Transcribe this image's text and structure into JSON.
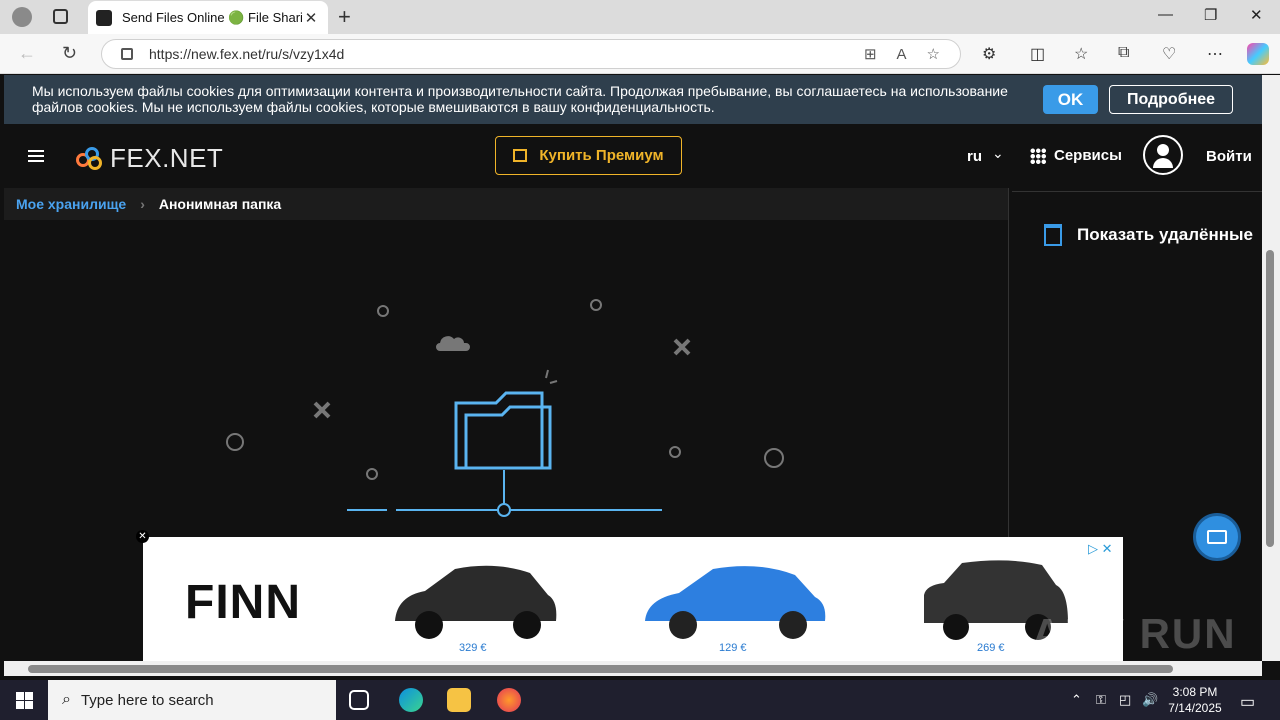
{
  "browser": {
    "tab_title": "Send Files Online 🟢 File Sharing",
    "url": "https://new.fex.net/ru/s/vzy1x4d"
  },
  "cookie": {
    "text": "Мы используем файлы cookies для оптимизации контента и производительности сайта. Продолжая пребывание, вы соглашаетесь на использование файлов cookies. Мы не используем файлы cookies, которые вмешиваются в вашу конфиденциальность.",
    "ok_label": "OK",
    "more_label": "Подробнее"
  },
  "header": {
    "logo_text": "FEX.NET",
    "premium_label": "Купить Премиум",
    "lang": "ru",
    "services_label": "Сервисы",
    "login_label": "Войти"
  },
  "breadcrumb": {
    "root": "Мое хранилище",
    "current": "Анонимная папка"
  },
  "sidebar": {
    "show_deleted": "Показать удалённые"
  },
  "ad": {
    "brand": "FINN",
    "prices": [
      "329 €",
      "129 €",
      "269 €"
    ]
  },
  "watermark": "ANY RUN",
  "taskbar": {
    "search_placeholder": "Type here to search",
    "time": "3:08 PM",
    "date": "7/14/2025"
  },
  "colors": {
    "accent": "#3a9be8",
    "premium": "#f0b429",
    "cookie_bg": "#2f3f4d"
  }
}
